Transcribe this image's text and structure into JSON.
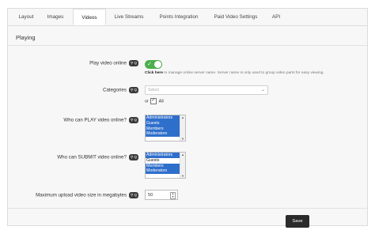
{
  "tabs": [
    {
      "label": "Layout"
    },
    {
      "label": "Images"
    },
    {
      "label": "Videos"
    },
    {
      "label": "Live Streams"
    },
    {
      "label": "Points Integration"
    },
    {
      "label": "Paid Video Settings"
    },
    {
      "label": "API"
    }
  ],
  "active_tab": "Videos",
  "section": {
    "title": "Playing"
  },
  "help_label": "Q",
  "fields": {
    "play_online": {
      "label": "Play video online",
      "toggle_on": true,
      "hint_link": "Click here",
      "hint_text": "to manage online server name. Server name is only used to group video parts for easy viewing."
    },
    "categories": {
      "label": "Categories",
      "placeholder": "Select",
      "or_text": "or",
      "all_label": "All",
      "all_checked": true
    },
    "who_play": {
      "label": "Who can PLAY video online?",
      "options": [
        {
          "text": "Administrators",
          "selected": true
        },
        {
          "text": "Guests",
          "selected": true
        },
        {
          "text": "Members",
          "selected": true
        },
        {
          "text": "Moderators",
          "selected": true
        }
      ]
    },
    "who_submit": {
      "label": "Who can SUBMIT video online?",
      "options": [
        {
          "text": "Administrators",
          "selected": true
        },
        {
          "text": "Guests",
          "selected": false
        },
        {
          "text": "Members",
          "selected": true
        },
        {
          "text": "Moderators",
          "selected": true
        }
      ]
    },
    "max_upload": {
      "label": "Maximum upload video size in megabytes",
      "value": "50"
    }
  },
  "save_label": "Save"
}
